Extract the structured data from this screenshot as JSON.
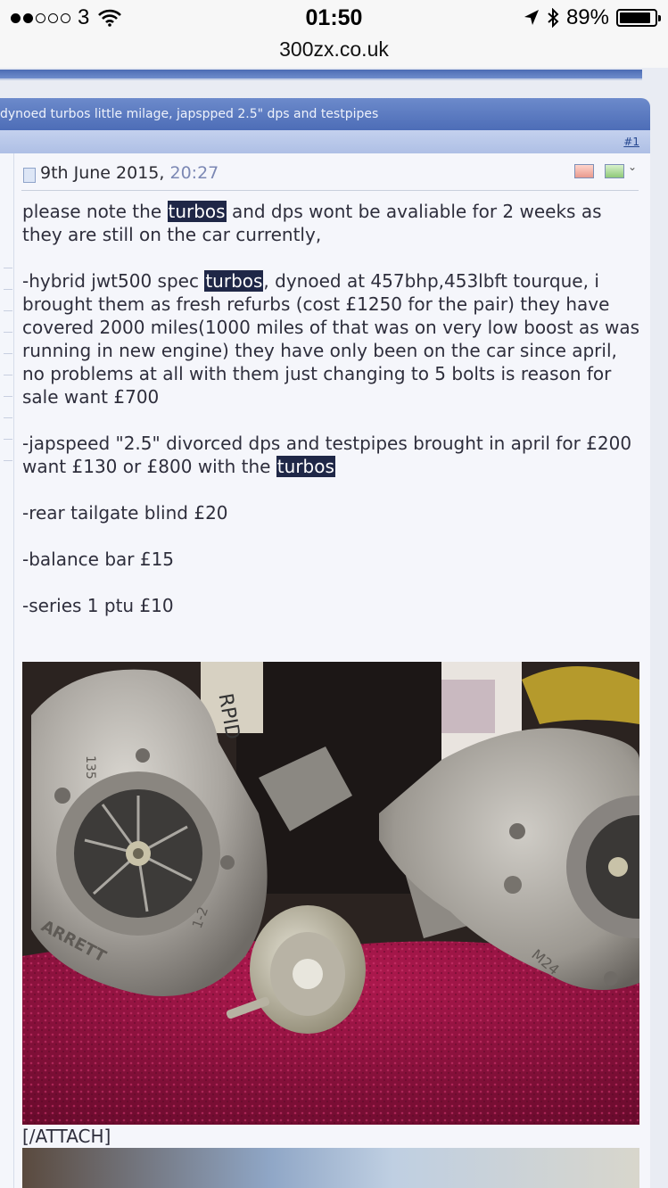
{
  "status_bar": {
    "carrier": "3",
    "time": "01:50",
    "battery_percent": "89%",
    "battery_level": 0.89,
    "signal_bars_filled": 2,
    "signal_bars_total": 5
  },
  "url": "300zx.co.uk",
  "thread": {
    "title": "dynoed turbos little milage, japspped 2.5\" dps and testpipes",
    "post_number": "#1"
  },
  "post": {
    "date": "9th June 2015,",
    "time": "20:27",
    "p1_a": "please note the ",
    "p1_hl": "turbos",
    "p1_b": " and dps wont be avaliable for 2 weeks as they are still on the car currently,",
    "p2_a": "-hybrid jwt500 spec ",
    "p2_hl": "turbos",
    "p2_b": ", dynoed at 457bhp,453lbft tourque, i brought them as fresh refurbs (cost £1250 for the pair) they have covered 2000 miles(1000 miles of that was on very low boost as was running in new engine) they have only been on the car since april, no problems at all with them just changing to 5 bolts is reason for sale want £700",
    "p3_a": "-japspeed \"2.5\" divorced dps and testpipes brought in april for £200 want £130 or £800 with the ",
    "p3_hl": "turbos",
    "item1": "-rear tailgate blind £20",
    "item2": "-balance bar £15",
    "item3": "-series 1 ptu £10",
    "attach_tag": "[/ATTACH]"
  },
  "photo_text": {
    "left_housing_letters": "ARRETT",
    "left_housing_mark": "1-2",
    "right_housing_mark": "M24",
    "casting_number": "135",
    "box_scrawl": "RPID"
  },
  "icons": {
    "wifi": "wifi-icon",
    "location": "location-arrow-icon",
    "bluetooth": "bluetooth-icon",
    "battery": "battery-icon",
    "post": "post-icon"
  }
}
